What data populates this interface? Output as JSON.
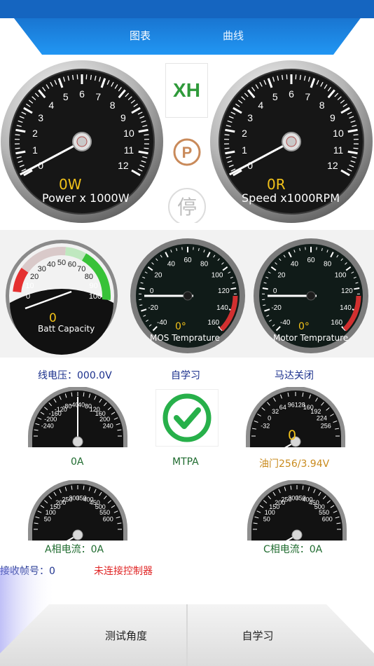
{
  "tabs": [
    {
      "label": "图表",
      "active": true
    },
    {
      "label": "曲线",
      "active": false
    }
  ],
  "colors": {
    "header_blue": "#1e88e5",
    "accent_green": "#2f9a3a",
    "warning_red": "#e02424",
    "label_blue": "#1a2f8c"
  },
  "status": {
    "xh": "XH",
    "park_icon": "park-icon",
    "stop_text": "停"
  },
  "power_gauge": {
    "value_text": "0W",
    "label": "Power x 1000W",
    "ticks": [
      "0",
      "1",
      "2",
      "3",
      "4",
      "5",
      "6",
      "7",
      "8",
      "9",
      "10",
      "11",
      "12"
    ]
  },
  "speed_gauge": {
    "value_text": "0R",
    "label": "Speed x1000RPM",
    "ticks": [
      "0",
      "1",
      "2",
      "3",
      "4",
      "5",
      "6",
      "7",
      "8",
      "9",
      "10",
      "11",
      "12"
    ]
  },
  "batt_gauge": {
    "value_text": "0",
    "label": "Batt Capacity",
    "ticks": [
      "0",
      "10",
      "20",
      "30",
      "40",
      "50",
      "60",
      "70",
      "80",
      "90",
      "100"
    ]
  },
  "mos_gauge": {
    "value_text": "0°",
    "label": "MOS Temprature",
    "ticks": [
      "-40",
      "-20",
      "0",
      "20",
      "40",
      "60",
      "80",
      "100",
      "120",
      "140",
      "160"
    ]
  },
  "motor_gauge": {
    "value_text": "0°",
    "label": "Motor Temprature",
    "ticks": [
      "-40",
      "-20",
      "0",
      "20",
      "40",
      "60",
      "80",
      "100",
      "120",
      "140",
      "160"
    ]
  },
  "info_row": {
    "line_voltage": "线电压：000.0V",
    "self_learn": "自学习",
    "motor_state": "马达关闭"
  },
  "current_gauge": {
    "ticks_left": [
      "-40",
      "-80",
      "-120",
      "-160",
      "-200",
      "-240"
    ],
    "ticks_right": [
      "40",
      "80",
      "120",
      "160",
      "200",
      "240"
    ],
    "caption": "0A"
  },
  "mtpa": {
    "caption": "MTPA",
    "icon": "checkmark-icon"
  },
  "throttle_gauge": {
    "ticks": [
      "-32",
      "0",
      "32",
      "64",
      "96",
      "128",
      "160",
      "192",
      "224",
      "256"
    ],
    "value_text": "0",
    "caption": "油门256/3.94V"
  },
  "phase_a_gauge": {
    "ticks": [
      "50",
      "100",
      "150",
      "200",
      "250",
      "300",
      "350",
      "400",
      "450",
      "500",
      "550",
      "600"
    ],
    "caption": "A相电流：0A"
  },
  "phase_c_gauge": {
    "ticks": [
      "50",
      "100",
      "150",
      "200",
      "250",
      "300",
      "350",
      "400",
      "450",
      "500",
      "550",
      "600"
    ],
    "caption": "C相电流：0A"
  },
  "footer_status": {
    "frame_no": "接收帧号：0",
    "controller": "未连接控制器"
  },
  "buttons": {
    "test_angle": "测试角度",
    "self_learn": "自学习"
  }
}
